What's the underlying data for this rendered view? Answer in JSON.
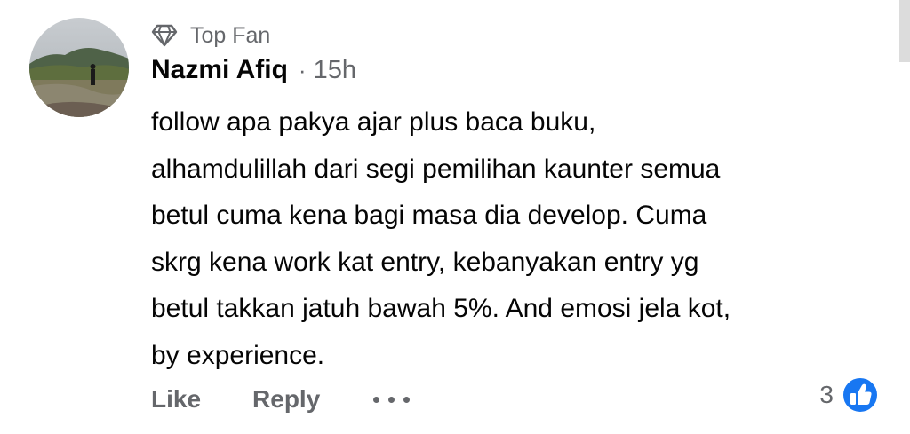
{
  "comment": {
    "badge": {
      "icon": "diamond-icon",
      "label": "Top Fan"
    },
    "author": "Nazmi Afiq",
    "separator": "·",
    "timestamp": "15h",
    "avatar": {
      "description_icon": "avatar"
    },
    "lines": [
      "follow apa pakya ajar plus baca buku,",
      "alhamdulillah dari segi pemilihan kaunter semua",
      "betul cuma kena bagi masa dia develop. Cuma",
      "skrg kena work kat entry, kebanyakan entry yg",
      "betul takkan jatuh bawah 5%. And emosi jela kot,",
      "by experience."
    ],
    "actions": {
      "like_label": "Like",
      "reply_label": "Reply",
      "more_icon": "more-options-icon"
    },
    "reactions": {
      "count": "3",
      "icon": "like-reaction-icon",
      "color": "#1877f2"
    }
  }
}
